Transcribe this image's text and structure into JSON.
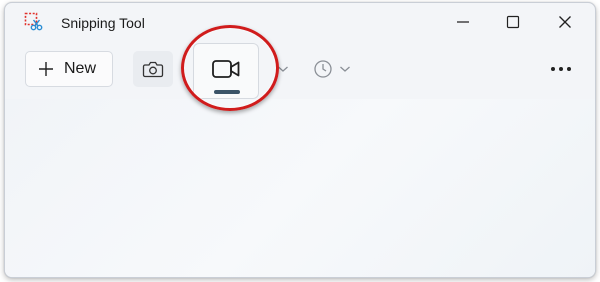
{
  "window": {
    "title": "Snipping Tool",
    "app_icon": "scissors-snip-icon"
  },
  "title_buttons": {
    "minimize_icon": "minimize-icon",
    "maximize_icon": "maximize-icon",
    "close_icon": "close-icon"
  },
  "toolbar": {
    "new_label": "New",
    "new_icon": "plus-icon",
    "screenshot_mode_icon": "camera-icon",
    "record_mode_icon": "video-camera-icon",
    "snip_mode_dropdown_icon": "chevron-down-icon",
    "delay_icon": "clock-icon",
    "delay_dropdown_icon": "chevron-down-icon",
    "more_icon": "more-horizontal-icon"
  },
  "annotation": {
    "highlight": "red-circle-around-record-button",
    "color": "#d01c1c"
  },
  "colors": {
    "accent_indicator": "#3b5468",
    "window_bg": "#f3f5f8"
  }
}
